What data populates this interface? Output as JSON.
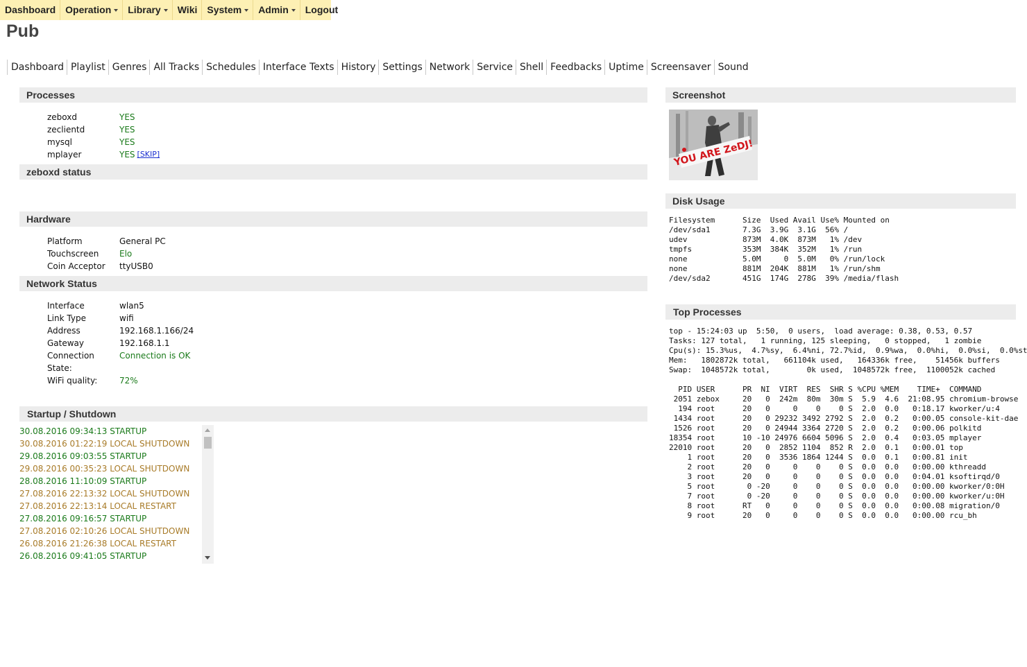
{
  "topmenu": [
    {
      "label": "Dashboard",
      "dropdown": false
    },
    {
      "label": "Operation",
      "dropdown": true
    },
    {
      "label": "Library",
      "dropdown": true
    },
    {
      "label": "Wiki",
      "dropdown": false
    },
    {
      "label": "System",
      "dropdown": true
    },
    {
      "label": "Admin",
      "dropdown": true
    },
    {
      "label": "Logout",
      "dropdown": false
    }
  ],
  "page_title": "Pub",
  "subnav": [
    "Dashboard",
    "Playlist",
    "Genres",
    "All Tracks",
    "Schedules",
    "Interface Texts",
    "History",
    "Settings",
    "Network",
    "Service",
    "Shell",
    "Feedbacks",
    "Uptime",
    "Screensaver",
    "Sound"
  ],
  "processes": {
    "title": "Processes",
    "rows": [
      {
        "name": "zeboxd",
        "status": "YES"
      },
      {
        "name": "zeclientd",
        "status": "YES"
      },
      {
        "name": "mysql",
        "status": "YES"
      },
      {
        "name": "mplayer",
        "status": "YES",
        "link": "[SKIP]"
      }
    ]
  },
  "zeboxd_status": {
    "title": "zeboxd status"
  },
  "hardware": {
    "title": "Hardware",
    "rows": [
      {
        "label": "Platform",
        "value": "General PC"
      },
      {
        "label": "Touchscreen",
        "value": "Elo"
      },
      {
        "label": "Coin Acceptor",
        "value": "ttyUSB0"
      }
    ]
  },
  "network": {
    "title": "Network Status",
    "rows": [
      {
        "label": "Interface",
        "value": "wlan5"
      },
      {
        "label": "Link Type",
        "value": "wifi"
      },
      {
        "label": "Address",
        "value": "192.168.1.166/24"
      },
      {
        "label": "Gateway",
        "value": "192.168.1.1"
      },
      {
        "label": "Connection",
        "label2": "State:",
        "value": "Connection is OK"
      },
      {
        "label": "WiFi quality:",
        "value": "72%"
      }
    ]
  },
  "startup": {
    "title": "Startup / Shutdown",
    "entries": [
      {
        "text": "30.08.2016 09:34:13 STARTUP",
        "kind": "start"
      },
      {
        "text": "30.08.2016 01:22:19 LOCAL SHUTDOWN",
        "kind": "shut"
      },
      {
        "text": "29.08.2016 09:03:55 STARTUP",
        "kind": "start"
      },
      {
        "text": "29.08.2016 00:35:23 LOCAL SHUTDOWN",
        "kind": "shut"
      },
      {
        "text": "28.08.2016 11:10:09 STARTUP",
        "kind": "start"
      },
      {
        "text": "27.08.2016 22:13:32 LOCAL SHUTDOWN",
        "kind": "shut"
      },
      {
        "text": "27.08.2016 22:13:14 LOCAL RESTART",
        "kind": "shut"
      },
      {
        "text": "27.08.2016 09:16:57 STARTUP",
        "kind": "start"
      },
      {
        "text": "27.08.2016 02:10:26 LOCAL SHUTDOWN",
        "kind": "shut"
      },
      {
        "text": "26.08.2016 21:26:38 LOCAL RESTART",
        "kind": "shut"
      },
      {
        "text": "26.08.2016 09:41:05 STARTUP",
        "kind": "start"
      }
    ]
  },
  "screenshot": {
    "title": "Screenshot",
    "logo_text": "YOU ARE ZeDJ!"
  },
  "disk": {
    "title": "Disk Usage",
    "text": "Filesystem      Size  Used Avail Use% Mounted on\n/dev/sda1       7.3G  3.9G  3.1G  56% /\nudev            873M  4.0K  873M   1% /dev\ntmpfs           353M  384K  352M   1% /run\nnone            5.0M     0  5.0M   0% /run/lock\nnone            881M  204K  881M   1% /run/shm\n/dev/sda2       451G  174G  278G  39% /media/flash"
  },
  "top": {
    "title": "Top Processes",
    "text": "top - 15:24:03 up  5:50,  0 users,  load average: 0.38, 0.53, 0.57\nTasks: 127 total,   1 running, 125 sleeping,   0 stopped,   1 zombie\nCpu(s): 15.3%us,  4.7%sy,  6.4%ni, 72.7%id,  0.9%wa,  0.0%hi,  0.0%si,  0.0%st\nMem:   1802872k total,   661104k used,   164336k free,    51456k buffers\nSwap:  1048572k total,        0k used,  1048572k free,  1100052k cached\n\n  PID USER      PR  NI  VIRT  RES  SHR S %CPU %MEM    TIME+  COMMAND\n 2051 zebox     20   0  242m  80m  30m S  5.9  4.6  21:08.95 chromium-browse\n  194 root      20   0     0    0    0 S  2.0  0.0   0:18.17 kworker/u:4\n 1434 root      20   0 29232 3492 2792 S  2.0  0.2   0:00.05 console-kit-dae\n 1526 root      20   0 24944 3364 2720 S  2.0  0.2   0:00.06 polkitd\n18354 root      10 -10 24976 6604 5096 S  2.0  0.4   0:03.05 mplayer\n22010 root      20   0  2852 1104  852 R  2.0  0.1   0:00.01 top\n    1 root      20   0  3536 1864 1244 S  0.0  0.1   0:00.81 init\n    2 root      20   0     0    0    0 S  0.0  0.0   0:00.00 kthreadd\n    3 root      20   0     0    0    0 S  0.0  0.0   0:04.01 ksoftirqd/0\n    5 root       0 -20     0    0    0 S  0.0  0.0   0:00.00 kworker/0:0H\n    7 root       0 -20     0    0    0 S  0.0  0.0   0:00.00 kworker/u:0H\n    8 root      RT   0     0    0    0 S  0.0  0.0   0:00.08 migration/0\n    9 root      20   0     0    0    0 S  0.0  0.0   0:00.00 rcu_bh"
  },
  "colors": {
    "menu_bg": "#fdf0b4",
    "ok_green": "#1a7a1a",
    "shutdown_amber": "#a87b28",
    "section_bg": "#ececec",
    "link_blue": "#1a2fd0"
  }
}
